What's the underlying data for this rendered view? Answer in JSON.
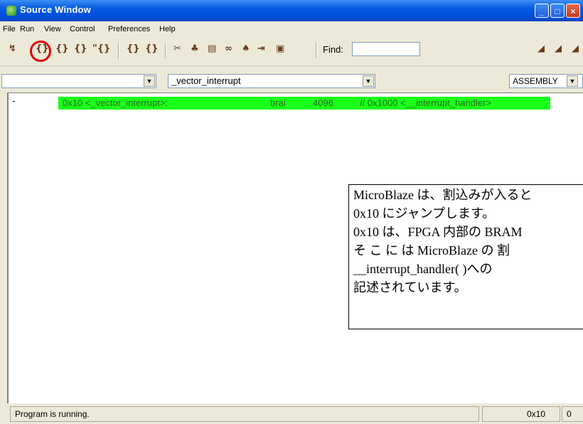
{
  "window": {
    "title": "Source Window"
  },
  "menu": [
    "File",
    "Run",
    "View",
    "Control",
    "Preferences",
    "Help"
  ],
  "toolbar": {
    "find_label": "Find:",
    "find_value": ""
  },
  "selectors": {
    "file_value": "",
    "function_value": "_vector_interrupt",
    "mode_value": "ASSEMBLY"
  },
  "source": {
    "marker": "-",
    "address_label": "0x10 <_vector_interrupt>:",
    "mnemonic": "brai",
    "operand": "4096",
    "comment": "// 0x1000 <__interrupt_handler>"
  },
  "note": {
    "lines": [
      "MicroBlaze は、割込みが入ると",
      "0x10 にジャンプします。",
      "0x10 は、FPGA 内部の BRAM",
      "そ こ に は  MicroBlaze  の 割",
      "__interrupt_handler( )への",
      "記述されています。"
    ]
  },
  "status": {
    "message": "Program is running.",
    "address": "0x10",
    "extra": "0"
  }
}
